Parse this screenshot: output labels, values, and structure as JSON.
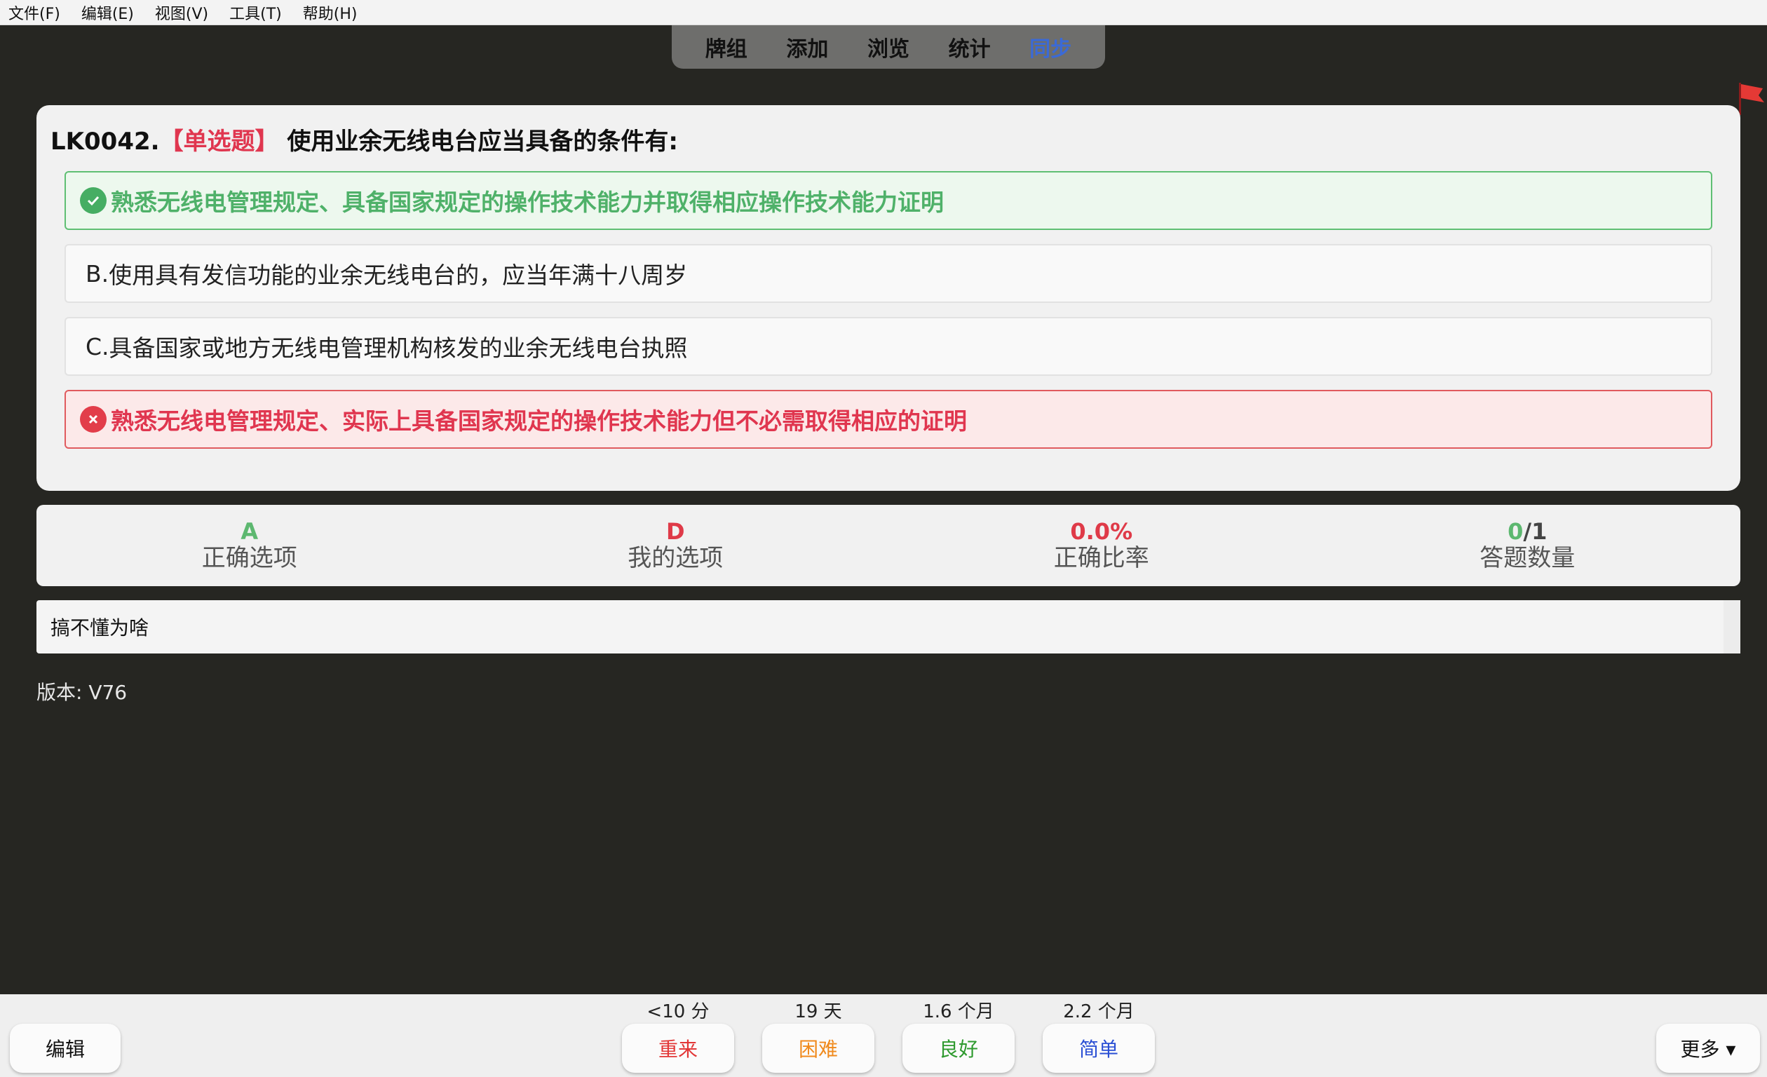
{
  "menu": [
    "文件(F)",
    "编辑(E)",
    "视图(V)",
    "工具(T)",
    "帮助(H)"
  ],
  "nav": {
    "items": [
      "牌组",
      "添加",
      "浏览",
      "统计",
      "同步"
    ],
    "active_index": 4
  },
  "question": {
    "id": "LK0042.",
    "type": "【单选题】",
    "text": "使用业余无线电台应当具备的条件有:",
    "options": [
      {
        "label": "",
        "text": "熟悉无线电管理规定、具备国家规定的操作技术能力并取得相应操作技术能力证明",
        "state": "correct"
      },
      {
        "label": "B.",
        "text": "使用具有发信功能的业余无线电台的，应当年满十八周岁",
        "state": "normal"
      },
      {
        "label": "C.",
        "text": "具备国家或地方无线电管理机构核发的业余无线电台执照",
        "state": "normal"
      },
      {
        "label": "",
        "text": "熟悉无线电管理规定、实际上具备国家规定的操作技术能力但不必需取得相应的证明",
        "state": "wrong"
      }
    ]
  },
  "stats": {
    "correct_option": {
      "value": "A",
      "label": "正确选项"
    },
    "my_option": {
      "value": "D",
      "label": "我的选项"
    },
    "accuracy": {
      "value": "0.0%",
      "label": "正确比率"
    },
    "answered": {
      "correct": "0",
      "slash": "/",
      "total": "1",
      "label": "答题数量"
    }
  },
  "notes": "搞不懂为啥",
  "version": "版本: V76",
  "bottom": {
    "edit": "编辑",
    "more": "更多 ▾",
    "answers": [
      {
        "interval": "<10 分",
        "label": "重来",
        "color": "#e23636"
      },
      {
        "interval": "19 天",
        "label": "困难",
        "color": "#f08a1c"
      },
      {
        "interval": "1.6 个月",
        "label": "良好",
        "color": "#2e9a2e"
      },
      {
        "interval": "2.2 个月",
        "label": "简单",
        "color": "#2a4fd4"
      }
    ]
  },
  "colors": {
    "background": "#262622",
    "correct": "#4fb169",
    "wrong": "#e0364f",
    "flag": "#e53935"
  }
}
